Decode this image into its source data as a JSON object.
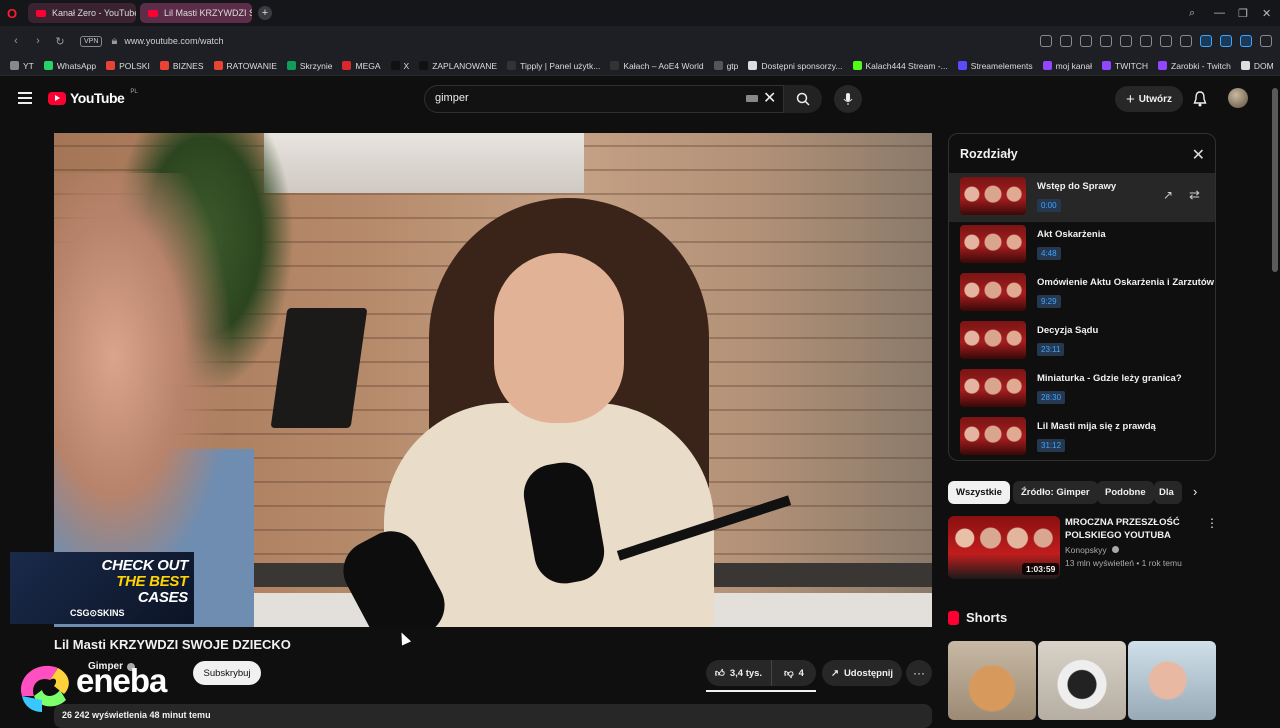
{
  "browser": {
    "tabs": [
      {
        "label": "Kanał Zero - YouTube"
      },
      {
        "label": "Lil Masti KRZYWDZI S"
      }
    ],
    "url": "www.youtube.com/watch",
    "vpn_label": "VPN",
    "bookmarks": [
      {
        "label": "YT",
        "color": "#888888"
      },
      {
        "label": "WhatsApp",
        "color": "#25d366"
      },
      {
        "label": "POLSKI",
        "color": "#ea4335"
      },
      {
        "label": "BIZNES",
        "color": "#ea4335"
      },
      {
        "label": "RATOWANIE",
        "color": "#ea4335"
      },
      {
        "label": "Skrzynie",
        "color": "#0f9d58"
      },
      {
        "label": "MEGA",
        "color": "#d9272e"
      },
      {
        "label": "X",
        "color": "#111111"
      },
      {
        "label": "ZAPLANOWANE",
        "color": "#111111"
      },
      {
        "label": "Tipply | Panel użytk...",
        "color": "#333333"
      },
      {
        "label": "Kałach – AoE4 World",
        "color": "#333333"
      },
      {
        "label": "gtp",
        "color": "#555555"
      },
      {
        "label": "Dostępni sponsorzy...",
        "color": "#dddddd"
      },
      {
        "label": "Kalach444 Stream -...",
        "color": "#53fc18"
      },
      {
        "label": "Streamelements",
        "color": "#5b4bff"
      },
      {
        "label": "moj kanał",
        "color": "#9146ff"
      },
      {
        "label": "TWITCH",
        "color": "#9146ff"
      },
      {
        "label": "Zarobki - Twitch",
        "color": "#9146ff"
      },
      {
        "label": "DOM",
        "color": "#dddddd"
      }
    ]
  },
  "header": {
    "logo_text": "YouTube",
    "region": "PL",
    "search_value": "gimper",
    "create_label": "Utwórz"
  },
  "video": {
    "title": "Lil Masti KRZYWDZI SWOJE DZIECKO",
    "channel": "Gimper",
    "subscribe_label": "Subskrybuj",
    "likes": "3,4 tys.",
    "dislikes": "4",
    "share_label": "Udostępnij",
    "views_line": "26 242 wyświetlenia  48 minut temu",
    "promo": {
      "line1": "CHECK OUT",
      "line2": "THE BEST",
      "line3": "CASES",
      "brand": "CSG⊙SKINS"
    },
    "overlay_brand": "eneba"
  },
  "chapters": {
    "title": "Rozdziały",
    "items": [
      {
        "title": "Wstęp do Sprawy",
        "time": "0:00"
      },
      {
        "title": "Akt Oskarżenia",
        "time": "4:48"
      },
      {
        "title": "Omówienie Aktu Oskarżenia i Zarzutów",
        "time": "9:29"
      },
      {
        "title": "Decyzja Sądu",
        "time": "23:11"
      },
      {
        "title": "Miniaturka - Gdzie leży granica?",
        "time": "28:30"
      },
      {
        "title": "Lil Masti mija się z prawdą",
        "time": "31:12"
      }
    ]
  },
  "filters": {
    "chips": [
      "Wszystkie",
      "Źródło: Gimper",
      "Podobne",
      "Dla"
    ]
  },
  "related": {
    "title": "MROCZNA PRZESZŁOŚĆ POLSKIEGO YOUTUBA",
    "channel": "Konopskyy",
    "meta": "13 mln wyświetleń • 1 rok temu",
    "duration": "1:03:59"
  },
  "shorts": {
    "heading": "Shorts"
  }
}
